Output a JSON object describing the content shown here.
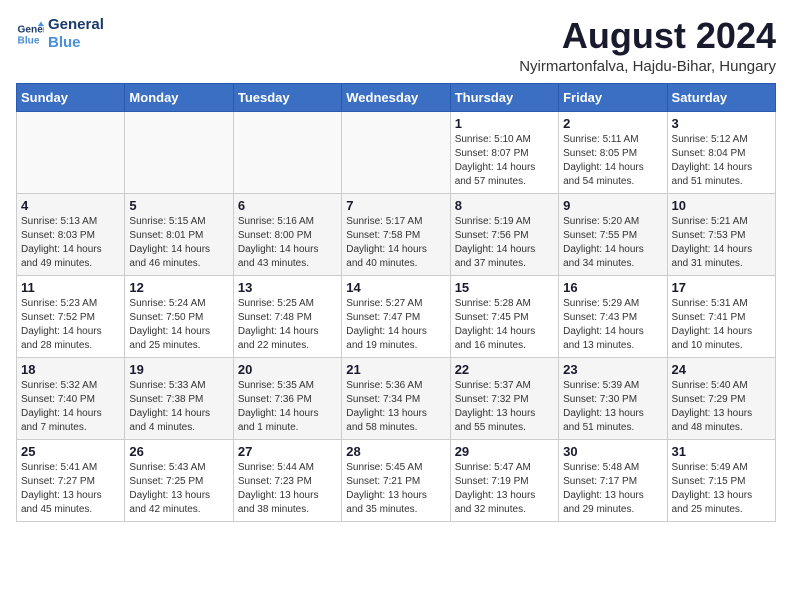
{
  "header": {
    "logo_line1": "General",
    "logo_line2": "Blue",
    "month_year": "August 2024",
    "location": "Nyirmartonfalva, Hajdu-Bihar, Hungary"
  },
  "weekdays": [
    "Sunday",
    "Monday",
    "Tuesday",
    "Wednesday",
    "Thursday",
    "Friday",
    "Saturday"
  ],
  "weeks": [
    [
      {
        "day": "",
        "info": ""
      },
      {
        "day": "",
        "info": ""
      },
      {
        "day": "",
        "info": ""
      },
      {
        "day": "",
        "info": ""
      },
      {
        "day": "1",
        "info": "Sunrise: 5:10 AM\nSunset: 8:07 PM\nDaylight: 14 hours\nand 57 minutes."
      },
      {
        "day": "2",
        "info": "Sunrise: 5:11 AM\nSunset: 8:05 PM\nDaylight: 14 hours\nand 54 minutes."
      },
      {
        "day": "3",
        "info": "Sunrise: 5:12 AM\nSunset: 8:04 PM\nDaylight: 14 hours\nand 51 minutes."
      }
    ],
    [
      {
        "day": "4",
        "info": "Sunrise: 5:13 AM\nSunset: 8:03 PM\nDaylight: 14 hours\nand 49 minutes."
      },
      {
        "day": "5",
        "info": "Sunrise: 5:15 AM\nSunset: 8:01 PM\nDaylight: 14 hours\nand 46 minutes."
      },
      {
        "day": "6",
        "info": "Sunrise: 5:16 AM\nSunset: 8:00 PM\nDaylight: 14 hours\nand 43 minutes."
      },
      {
        "day": "7",
        "info": "Sunrise: 5:17 AM\nSunset: 7:58 PM\nDaylight: 14 hours\nand 40 minutes."
      },
      {
        "day": "8",
        "info": "Sunrise: 5:19 AM\nSunset: 7:56 PM\nDaylight: 14 hours\nand 37 minutes."
      },
      {
        "day": "9",
        "info": "Sunrise: 5:20 AM\nSunset: 7:55 PM\nDaylight: 14 hours\nand 34 minutes."
      },
      {
        "day": "10",
        "info": "Sunrise: 5:21 AM\nSunset: 7:53 PM\nDaylight: 14 hours\nand 31 minutes."
      }
    ],
    [
      {
        "day": "11",
        "info": "Sunrise: 5:23 AM\nSunset: 7:52 PM\nDaylight: 14 hours\nand 28 minutes."
      },
      {
        "day": "12",
        "info": "Sunrise: 5:24 AM\nSunset: 7:50 PM\nDaylight: 14 hours\nand 25 minutes."
      },
      {
        "day": "13",
        "info": "Sunrise: 5:25 AM\nSunset: 7:48 PM\nDaylight: 14 hours\nand 22 minutes."
      },
      {
        "day": "14",
        "info": "Sunrise: 5:27 AM\nSunset: 7:47 PM\nDaylight: 14 hours\nand 19 minutes."
      },
      {
        "day": "15",
        "info": "Sunrise: 5:28 AM\nSunset: 7:45 PM\nDaylight: 14 hours\nand 16 minutes."
      },
      {
        "day": "16",
        "info": "Sunrise: 5:29 AM\nSunset: 7:43 PM\nDaylight: 14 hours\nand 13 minutes."
      },
      {
        "day": "17",
        "info": "Sunrise: 5:31 AM\nSunset: 7:41 PM\nDaylight: 14 hours\nand 10 minutes."
      }
    ],
    [
      {
        "day": "18",
        "info": "Sunrise: 5:32 AM\nSunset: 7:40 PM\nDaylight: 14 hours\nand 7 minutes."
      },
      {
        "day": "19",
        "info": "Sunrise: 5:33 AM\nSunset: 7:38 PM\nDaylight: 14 hours\nand 4 minutes."
      },
      {
        "day": "20",
        "info": "Sunrise: 5:35 AM\nSunset: 7:36 PM\nDaylight: 14 hours\nand 1 minute."
      },
      {
        "day": "21",
        "info": "Sunrise: 5:36 AM\nSunset: 7:34 PM\nDaylight: 13 hours\nand 58 minutes."
      },
      {
        "day": "22",
        "info": "Sunrise: 5:37 AM\nSunset: 7:32 PM\nDaylight: 13 hours\nand 55 minutes."
      },
      {
        "day": "23",
        "info": "Sunrise: 5:39 AM\nSunset: 7:30 PM\nDaylight: 13 hours\nand 51 minutes."
      },
      {
        "day": "24",
        "info": "Sunrise: 5:40 AM\nSunset: 7:29 PM\nDaylight: 13 hours\nand 48 minutes."
      }
    ],
    [
      {
        "day": "25",
        "info": "Sunrise: 5:41 AM\nSunset: 7:27 PM\nDaylight: 13 hours\nand 45 minutes."
      },
      {
        "day": "26",
        "info": "Sunrise: 5:43 AM\nSunset: 7:25 PM\nDaylight: 13 hours\nand 42 minutes."
      },
      {
        "day": "27",
        "info": "Sunrise: 5:44 AM\nSunset: 7:23 PM\nDaylight: 13 hours\nand 38 minutes."
      },
      {
        "day": "28",
        "info": "Sunrise: 5:45 AM\nSunset: 7:21 PM\nDaylight: 13 hours\nand 35 minutes."
      },
      {
        "day": "29",
        "info": "Sunrise: 5:47 AM\nSunset: 7:19 PM\nDaylight: 13 hours\nand 32 minutes."
      },
      {
        "day": "30",
        "info": "Sunrise: 5:48 AM\nSunset: 7:17 PM\nDaylight: 13 hours\nand 29 minutes."
      },
      {
        "day": "31",
        "info": "Sunrise: 5:49 AM\nSunset: 7:15 PM\nDaylight: 13 hours\nand 25 minutes."
      }
    ]
  ]
}
